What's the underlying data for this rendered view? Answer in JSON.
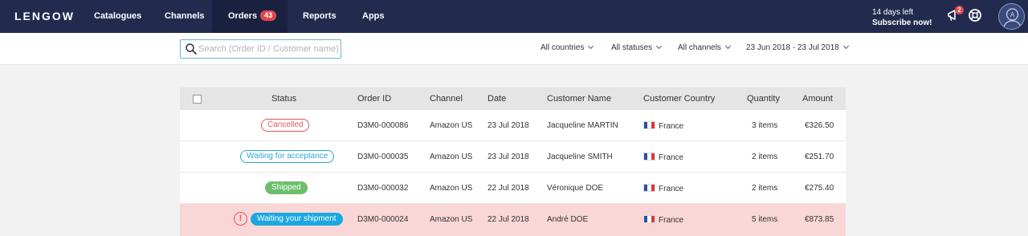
{
  "brand": {
    "logo": "LENGOW"
  },
  "nav": {
    "items": [
      {
        "label": "Catalogues"
      },
      {
        "label": "Channels"
      },
      {
        "label": "Orders",
        "badge": "43"
      },
      {
        "label": "Reports"
      },
      {
        "label": "Apps"
      }
    ],
    "active": "Orders"
  },
  "trial": {
    "days_left": "14 days left",
    "cta": "Subscribe now!"
  },
  "notifications": {
    "count": "2"
  },
  "icons": {
    "bell": "megaphone-icon",
    "help": "lifebuoy-icon",
    "avatar": "user-avatar-icon",
    "search": "search-icon"
  },
  "filters": {
    "search_placeholder": "Search (Order ID / Customer name)",
    "search_value": "",
    "country": "All countries",
    "status": "All statuses",
    "channel": "All channels",
    "date_range": "23 Jun 2018 - 23 Jul 2018"
  },
  "table": {
    "columns": {
      "status": "Status",
      "order_id": "Order ID",
      "channel": "Channel",
      "date": "Date",
      "customer": "Customer Name",
      "country": "Customer Country",
      "quantity": "Quantity",
      "amount": "Amount"
    },
    "rows": [
      {
        "status": "Cancelled",
        "status_type": "cancelled",
        "order_id": "D3M0-000086",
        "channel": "Amazon US",
        "date": "23 Jul 2018",
        "customer": "Jacqueline MARTIN",
        "country": "France",
        "quantity": "3 items",
        "amount": "€326.50",
        "alert": false
      },
      {
        "status": "Waiting for acceptance",
        "status_type": "waiting",
        "order_id": "D3M0-000035",
        "channel": "Amazon US",
        "date": "23 Jul 2018",
        "customer": "Jacqueline SMITH",
        "country": "France",
        "quantity": "2 items",
        "amount": "€251.70",
        "alert": false
      },
      {
        "status": "Shipped",
        "status_type": "shipped",
        "order_id": "D3M0-000032",
        "channel": "Amazon US",
        "date": "22 Jul 2018",
        "customer": "Véronique DOE",
        "country": "France",
        "quantity": "2 items",
        "amount": "€275.40",
        "alert": false
      },
      {
        "status": "Waiting your shipment",
        "status_type": "shipment",
        "order_id": "D3M0-000024",
        "channel": "Amazon US",
        "date": "22 Jul 2018",
        "customer": "André DOE",
        "country": "France",
        "quantity": "5 items",
        "amount": "€873.85",
        "alert": true,
        "alert_symbol": "!"
      }
    ]
  },
  "colors": {
    "nav_bg": "#222b4e",
    "cancelled": "#e0575b",
    "waiting": "#2aa7d8",
    "shipped": "#6cbf6b",
    "shipment": "#1ca7e0",
    "alert_row": "#f9d7d7"
  }
}
